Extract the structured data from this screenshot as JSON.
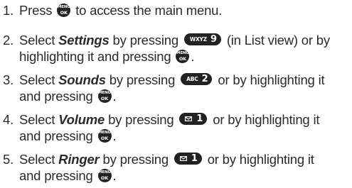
{
  "keys": {
    "menu_top": "MENU",
    "menu_bottom": "OK",
    "wxyz": "WXYZ",
    "wxyz_digit": "9",
    "abc": "ABC",
    "abc_digit": "2",
    "one_digit": "1"
  },
  "steps": [
    {
      "number": "1.",
      "text_a": "Press",
      "text_b": "to access the main menu."
    },
    {
      "number": "2.",
      "text_a": "Select",
      "emphasis": "Settings",
      "text_b": "by pressing",
      "text_c": "(in List view) or by",
      "text_d": "highlighting it and pressing",
      "text_e": "."
    },
    {
      "number": "3.",
      "text_a": "Select",
      "emphasis": "Sounds",
      "text_b": "by pressing",
      "text_c": "or by highlighting it",
      "text_d": "and pressing",
      "text_e": "."
    },
    {
      "number": "4.",
      "text_a": "Select",
      "emphasis": "Volume",
      "text_b": "by pressing",
      "text_c": "or by highlighting it",
      "text_d": "and pressing",
      "text_e": "."
    },
    {
      "number": "5.",
      "text_a": "Select",
      "emphasis": "Ringer",
      "text_b": "by pressing",
      "text_c": "or by highlighting it",
      "text_d": "and pressing",
      "text_e": "."
    }
  ]
}
